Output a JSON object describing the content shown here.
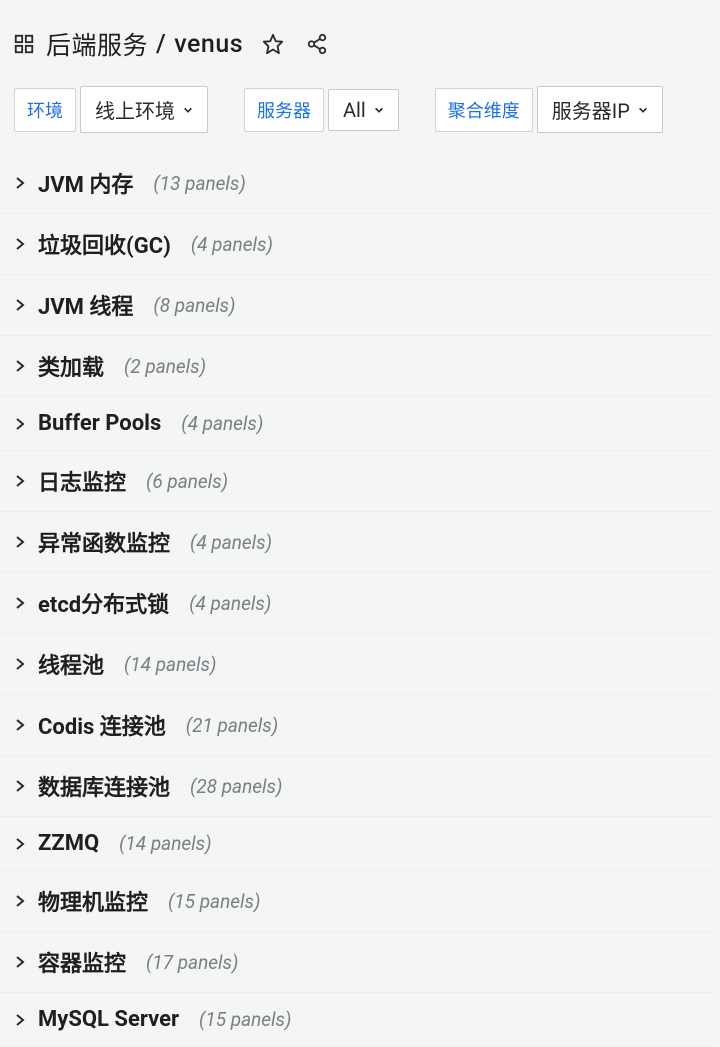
{
  "header": {
    "folder": "后端服务",
    "separator": "/",
    "name": "venus"
  },
  "filters": {
    "env": {
      "label": "环境",
      "value": "线上环境"
    },
    "server": {
      "label": "服务器",
      "value": "All"
    },
    "agg": {
      "label": "聚合维度",
      "value": "服务器IP"
    }
  },
  "rows": [
    {
      "title": "JVM 内存",
      "count": "(13 panels)"
    },
    {
      "title": "垃圾回收(GC)",
      "count": "(4 panels)"
    },
    {
      "title": "JVM 线程",
      "count": "(8 panels)"
    },
    {
      "title": "类加载",
      "count": "(2 panels)"
    },
    {
      "title": "Buffer Pools",
      "count": "(4 panels)"
    },
    {
      "title": "日志监控",
      "count": "(6 panels)"
    },
    {
      "title": "异常函数监控",
      "count": "(4 panels)"
    },
    {
      "title": "etcd分布式锁",
      "count": "(4 panels)"
    },
    {
      "title": "线程池",
      "count": "(14 panels)"
    },
    {
      "title": "Codis 连接池",
      "count": "(21 panels)"
    },
    {
      "title": "数据库连接池",
      "count": "(28 panels)"
    },
    {
      "title": "ZZMQ",
      "count": "(14 panels)"
    },
    {
      "title": "物理机监控",
      "count": "(15 panels)"
    },
    {
      "title": "容器监控",
      "count": "(17 panels)"
    },
    {
      "title": "MySQL Server",
      "count": "(15 panels)"
    }
  ]
}
